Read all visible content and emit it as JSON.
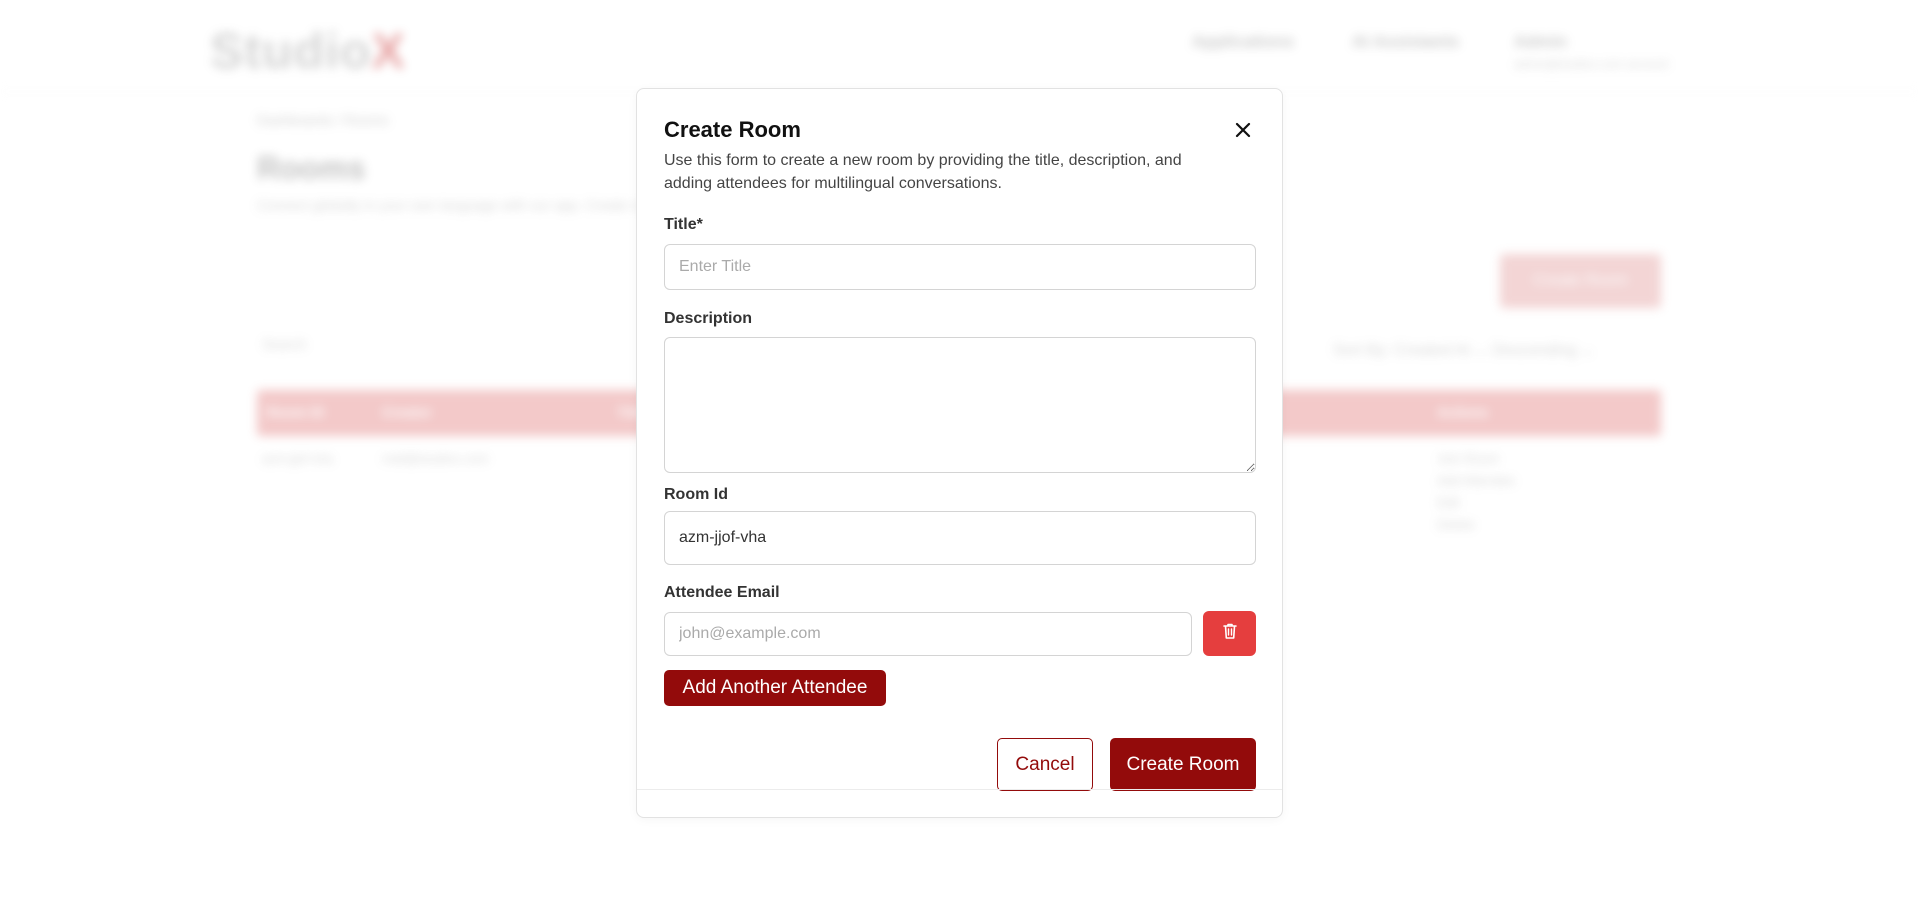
{
  "background": {
    "logo": {
      "main": "Studio",
      "accent": "X"
    },
    "nav": [
      "Applications",
      "AI Assistants",
      "Admin"
    ],
    "nav_sub": "admin@studiox.com account",
    "breadcrumb": "Dashboards / Rooms",
    "page_title": "Rooms",
    "page_desc": "Connect globally in your own language with our app. Create rooms and invite attendees, ensuring everyone speaks and understands effortlessly.",
    "create_button": "Create Room",
    "search_placeholder": "Search",
    "sort": "Sort By: Created At  ⌄   Descending  ⌄",
    "table_headers": [
      "Room ID",
      "Creator",
      "Title",
      "Actions"
    ],
    "row": {
      "room_id": "azm-jjof-vha",
      "creator": "mail@studiox.com",
      "actions": [
        "Join Room",
        "Add Attendee",
        "Edit",
        "Delete"
      ]
    }
  },
  "modal": {
    "title": "Create Room",
    "description": "Use this form to create a new room by providing the title, description, and adding attendees for multilingual conversations.",
    "title_label": "Title*",
    "title_placeholder": "Enter Title",
    "description_label": "Description",
    "room_id_label": "Room Id",
    "room_id_value": "azm-jjof-vha",
    "attendee_label": "Attendee Email",
    "attendee_placeholder": "john@example.com",
    "add_attendee_label": "Add Another Attendee",
    "cancel_label": "Cancel",
    "create_label": "Create Room"
  },
  "icons": {
    "close": "close-icon",
    "delete": "trash-icon"
  },
  "colors": {
    "primary": "#930b0b",
    "danger": "#e53e3e"
  }
}
